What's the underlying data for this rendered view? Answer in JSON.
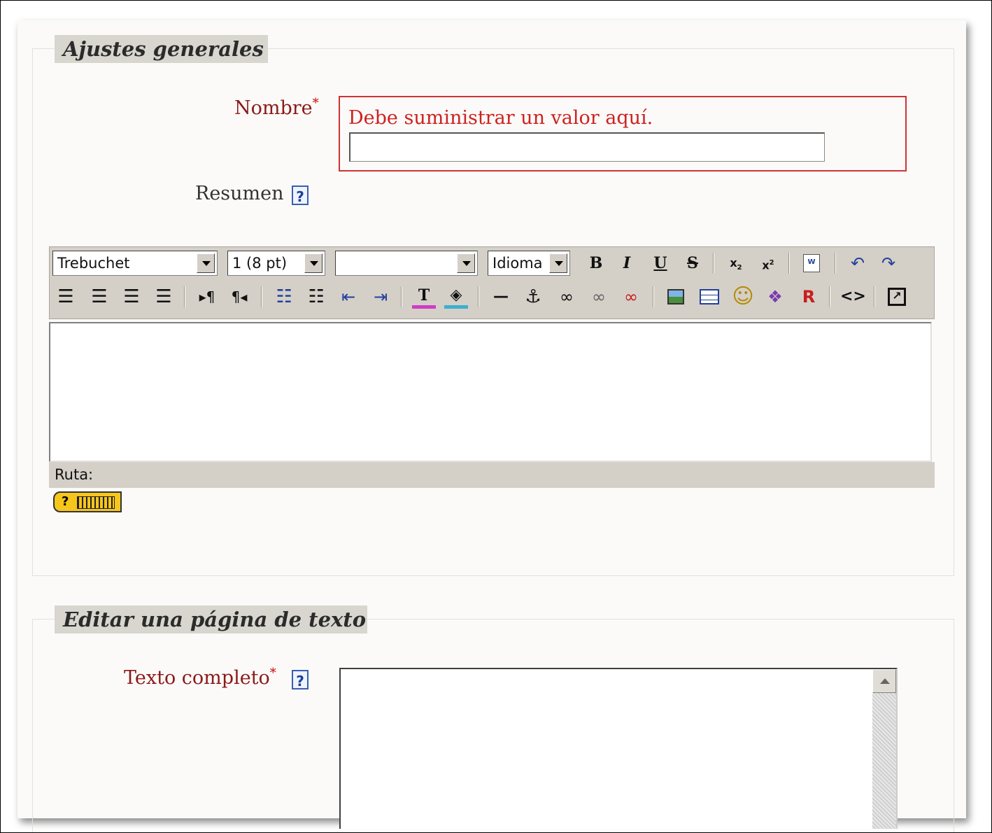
{
  "sections": {
    "general": {
      "title": "Ajustes generales",
      "name_label": "Nombre",
      "required_mark": "*",
      "error_message": "Debe suministrar un valor aquí.",
      "name_value": "",
      "summary_label": "Resumen",
      "help_glyph": "?"
    },
    "editor": {
      "font_family": "Trebuchet",
      "font_size": "1 (8 pt)",
      "heading": "",
      "language": "Idioma",
      "status_label": "Ruta:",
      "keyboard_help": "?",
      "icons": {
        "row1": [
          "bold-icon",
          "italic-icon",
          "underline-icon",
          "strikethrough-icon",
          "subscript-icon",
          "superscript-icon",
          "paste-word-icon",
          "undo-icon",
          "redo-icon"
        ],
        "row2": [
          "align-left-icon",
          "align-center-icon",
          "align-right-icon",
          "justify-icon",
          "ltr-icon",
          "rtl-icon",
          "ordered-list-icon",
          "unordered-list-icon",
          "outdent-icon",
          "indent-icon",
          "text-color-icon",
          "bg-color-icon",
          "horizontal-rule-icon",
          "anchor-icon",
          "link-icon",
          "unlink-icon",
          "nolink-icon",
          "image-icon",
          "table-icon",
          "smiley-icon",
          "special-char-icon",
          "search-replace-icon",
          "html-source-icon",
          "fullscreen-icon"
        ]
      }
    },
    "text_page": {
      "title": "Editar una página de texto",
      "fulltext_label": "Texto completo",
      "required_mark": "*",
      "help_glyph": "?",
      "fulltext_value": ""
    }
  },
  "colors": {
    "required_label": "#8b1a1a",
    "error": "#cc2222",
    "legend_bg": "#d9d6cf",
    "toolbar_bg": "#d4d0c8"
  }
}
